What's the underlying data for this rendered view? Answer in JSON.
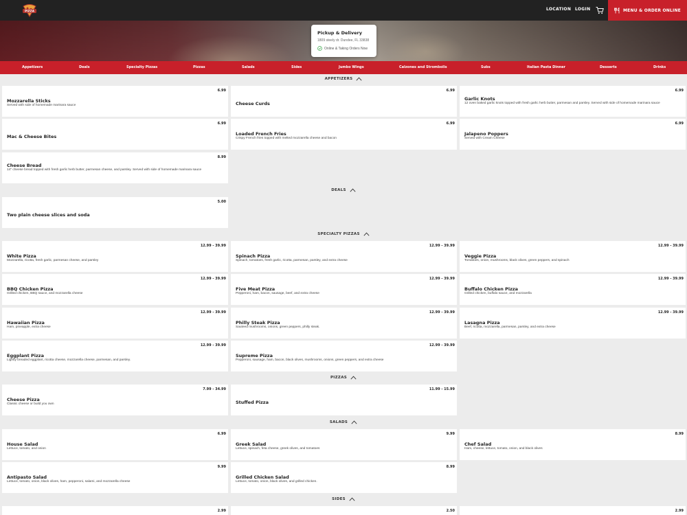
{
  "header": {
    "logo_text": "PIZZA",
    "location_label": "LOCATION",
    "login_label": "LOGIN",
    "cart_icon": "cart-icon",
    "order_label": "MENU & ORDER ONLINE",
    "order_icon": "utensils-icon"
  },
  "colors": {
    "brand_red": "#c8202a",
    "topbar": "#222222",
    "status_green": "#3aa84b"
  },
  "pickup": {
    "title": "Pickup & Delivery",
    "address": "1809 steely dr. Dundee, FL 33838",
    "status": "Online & Taking Orders Now"
  },
  "categories": [
    "Appetizers",
    "Deals",
    "Specialty Pizzas",
    "Pizzas",
    "Salads",
    "Sides",
    "Jumbo Wings",
    "Calzones and Strombolis",
    "Subs",
    "Italian Pasta Dinner",
    "Desserts",
    "Drinks"
  ],
  "sections": [
    {
      "title": "APPETIZERS",
      "items": [
        {
          "name": "Mozzarella Sticks",
          "desc": "Served with side of homemade marinara sauce",
          "price": "6.99"
        },
        {
          "name": "Cheese Curds",
          "desc": "",
          "price": "6.99"
        },
        {
          "name": "Garlic Knots",
          "desc": "12 oven baked garlic knots topped with fresh garlic herb butter, parmesan and parsley. Served with side of homemade marinara sauce",
          "price": "6.99"
        },
        {
          "name": "Mac & Cheese Bites",
          "desc": "",
          "price": "6.99"
        },
        {
          "name": "Loaded French Fries",
          "desc": "Crispy French fries topped with melted mozzarella cheese and bacon",
          "price": "6.99"
        },
        {
          "name": "Jalapeno Poppers",
          "desc": "Served with Cream Cheese",
          "price": "6.99"
        },
        {
          "name": "Cheese Bread",
          "desc": "14\" cheese bread topped with fresh garlic herb butter, parmesan cheese, and parsley. Served with side of homemade marinara sauce",
          "price": "8.99"
        }
      ]
    },
    {
      "title": "DEALS",
      "items": [
        {
          "name": "Two plain cheese slices and soda",
          "desc": "",
          "price": "5.00"
        }
      ]
    },
    {
      "title": "SPECIALTY PIZZAS",
      "items": [
        {
          "name": "White Pizza",
          "desc": "Mozzarella, ricotta, fresh garlic, parmesan cheese, and parsley",
          "price": "12.99 - 39.99"
        },
        {
          "name": "Spinach Pizza",
          "desc": "Spinach, tomatoes, fresh garlic, ricotta, parmesan, parsley, and extra cheese",
          "price": "12.99 - 39.99"
        },
        {
          "name": "Veggie Pizza",
          "desc": "Tomatoes, onion, mushrooms, black olives, green peppers, and spinach",
          "price": "12.99 - 39.99"
        },
        {
          "name": "BBQ Chicken Pizza",
          "desc": "Grilled chicken, BBQ sauce, and mozzarella cheese",
          "price": "12.99 - 39.99"
        },
        {
          "name": "Five Meat Pizza",
          "desc": "Pepperoni, ham, bacon, sausage, beef, and extra cheese",
          "price": "12.99 - 39.99"
        },
        {
          "name": "Buffalo Chicken Pizza",
          "desc": "Grilled chicken, buffalo sauce, and mozzarella",
          "price": "12.99 - 39.99"
        },
        {
          "name": "Hawaiian Pizza",
          "desc": "Ham, pineapple, extra cheese",
          "price": "12.99 - 39.99"
        },
        {
          "name": "Philly Steak Pizza",
          "desc": "Sauteed mushrooms, onions, green peppers, philly steak.",
          "price": "12.99 - 39.99"
        },
        {
          "name": "Lasagna Pizza",
          "desc": "Beef, ricotta, mozzarella, parmesan, parsley, and extra cheese",
          "price": "12.99 - 39.99"
        },
        {
          "name": "Eggplant Pizza",
          "desc": "Lightly breaded eggplant, ricotta cheese, mozzarella cheese, parmesan, and parsley.",
          "price": "12.99 - 39.99"
        },
        {
          "name": "Supreme Pizza",
          "desc": "Pepperoni, sausage, ham, bacon, black olives, mushrooms, onions, green peppers, and extra cheese",
          "price": "12.99 - 39.99"
        }
      ]
    },
    {
      "title": "PIZZAS",
      "items": [
        {
          "name": "Cheese Pizza",
          "desc": "Classic cheese or build you own",
          "price": "7.99 - 34.99"
        },
        {
          "name": "Stuffed Pizza",
          "desc": "",
          "price": "11.99 - 15.99"
        }
      ]
    },
    {
      "title": "SALADS",
      "items": [
        {
          "name": "House Salad",
          "desc": "Lettuce, tomato, and onion",
          "price": "6.99"
        },
        {
          "name": "Greek Salad",
          "desc": "Lettuce, spinach, feta cheese, greek olives, and tomatoes",
          "price": "9.99"
        },
        {
          "name": "Chef Salad",
          "desc": "Ham, cheese, lettuce, tomato, onion, and black olives",
          "price": "8.99"
        },
        {
          "name": "Antipasto Salad",
          "desc": "Lettuce, tomato, onion, black olives, ham, pepperoni, salami, and mozzarella cheese",
          "price": "9.99"
        },
        {
          "name": "Grilled Chicken Salad",
          "desc": "Lettuce, tomato, onion, black olives, and grilled chicken.",
          "price": "8.99"
        }
      ]
    },
    {
      "title": "SIDES",
      "items": [
        {
          "name": "",
          "desc": "",
          "price": "2.99"
        },
        {
          "name": "",
          "desc": "",
          "price": "2.50"
        },
        {
          "name": "",
          "desc": "",
          "price": "2.99"
        }
      ]
    }
  ]
}
